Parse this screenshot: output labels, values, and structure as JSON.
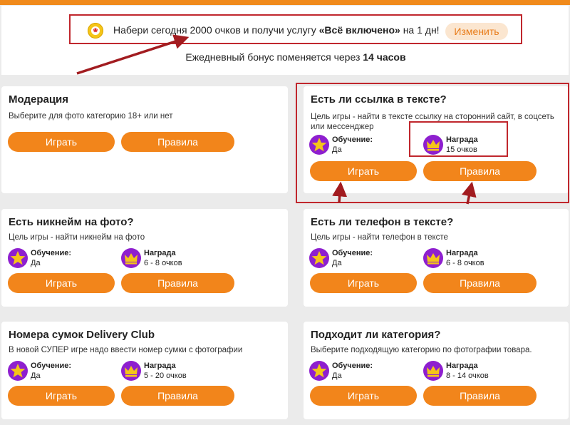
{
  "promo": {
    "text_before": "Набери сегодня 2000 очков и получи услугу ",
    "text_bold": "«Всё включено»",
    "text_after": " на 1 дн!",
    "change_label": "Изменить"
  },
  "bonus": {
    "text": "Ежедневный бонус поменяется через ",
    "hours": "14 часов"
  },
  "labels": {
    "training": "Обучение:",
    "reward": "Награда",
    "play": "Играть",
    "rules": "Правила"
  },
  "cards": [
    {
      "title": "Модерация",
      "desc": "Выберите для фото категорию 18+ или нет"
    },
    {
      "title": "Есть ли ссылка в тексте?",
      "desc": "Цель игры - найти в тексте ссылку на сторонний сайт, в соцсеть или мессенджер",
      "training": "Да",
      "reward": "15 очков"
    },
    {
      "title": "Есть никнейм на фото?",
      "desc": "Цель игры - найти никнейм на фото",
      "training": "Да",
      "reward": "6 - 8 очков"
    },
    {
      "title": "Есть ли телефон в тексте?",
      "desc": "Цель игры - найти телефон в тексте",
      "training": "Да",
      "reward": "6 - 8 очков"
    },
    {
      "title": "Номера сумок Delivery Club",
      "desc": "В новой СУПЕР игре надо ввести номер сумки с фотографии",
      "training": "Да",
      "reward": "5 - 20 очков"
    },
    {
      "title": "Подходит ли категория?",
      "desc": "Выберите подходящую категорию по фотографии товара.",
      "training": "Да",
      "reward": "8 - 14 очков"
    }
  ],
  "colors": {
    "accent": "#f2851b",
    "badge": "#8e1fcf",
    "highlight": "#c0272d",
    "icon": "#f5c518"
  },
  "icons": {
    "training": "star-icon",
    "reward": "crown-icon",
    "promo": "coin-icon"
  }
}
